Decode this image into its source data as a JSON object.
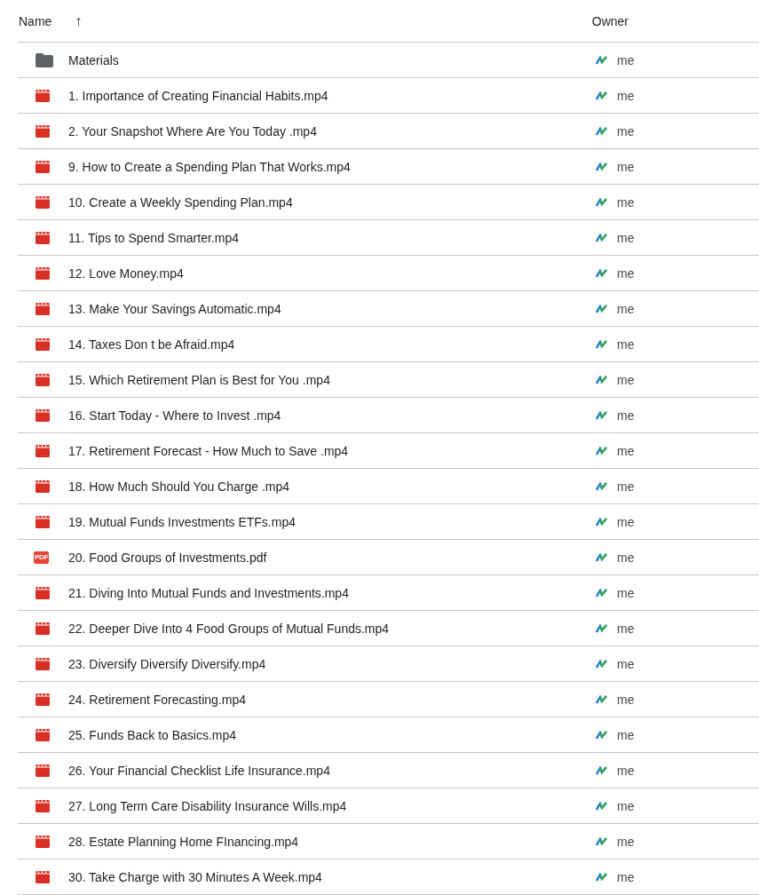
{
  "header": {
    "name_label": "Name",
    "sort_arrow": "↑",
    "owner_label": "Owner"
  },
  "files": [
    {
      "kind": "folder",
      "name": "Materials",
      "owner": "me"
    },
    {
      "kind": "video",
      "name": "1. Importance of Creating Financial Habits.mp4",
      "owner": "me"
    },
    {
      "kind": "video",
      "name": "2. Your Snapshot Where Are You Today .mp4",
      "owner": "me"
    },
    {
      "kind": "video",
      "name": "9. How to Create a Spending Plan That Works.mp4",
      "owner": "me"
    },
    {
      "kind": "video",
      "name": "10. Create a Weekly Spending Plan.mp4",
      "owner": "me"
    },
    {
      "kind": "video",
      "name": "11. Tips to Spend Smarter.mp4",
      "owner": "me"
    },
    {
      "kind": "video",
      "name": "12. Love Money.mp4",
      "owner": "me"
    },
    {
      "kind": "video",
      "name": "13. Make Your Savings Automatic.mp4",
      "owner": "me"
    },
    {
      "kind": "video",
      "name": "14. Taxes Don t be Afraid.mp4",
      "owner": "me"
    },
    {
      "kind": "video",
      "name": "15. Which Retirement Plan is Best for You .mp4",
      "owner": "me"
    },
    {
      "kind": "video",
      "name": "16. Start Today - Where to Invest .mp4",
      "owner": "me"
    },
    {
      "kind": "video",
      "name": "17. Retirement Forecast - How Much to Save .mp4",
      "owner": "me"
    },
    {
      "kind": "video",
      "name": "18. How Much Should You Charge .mp4",
      "owner": "me"
    },
    {
      "kind": "video",
      "name": "19. Mutual Funds Investments ETFs.mp4",
      "owner": "me"
    },
    {
      "kind": "pdf",
      "icon_label": "PDF",
      "name": "20. Food Groups of Investments.pdf",
      "owner": "me"
    },
    {
      "kind": "video",
      "name": "21. Diving Into Mutual Funds and Investments.mp4",
      "owner": "me"
    },
    {
      "kind": "video",
      "name": "22. Deeper Dive Into 4 Food Groups of Mutual Funds.mp4",
      "owner": "me"
    },
    {
      "kind": "video",
      "name": "23. Diversify Diversify Diversify.mp4",
      "owner": "me"
    },
    {
      "kind": "video",
      "name": "24. Retirement Forecasting.mp4",
      "owner": "me"
    },
    {
      "kind": "video",
      "name": "25. Funds Back to Basics.mp4",
      "owner": "me"
    },
    {
      "kind": "video",
      "name": "26. Your Financial Checklist Life Insurance.mp4",
      "owner": "me"
    },
    {
      "kind": "video",
      "name": "27. Long Term Care Disability Insurance Wills.mp4",
      "owner": "me"
    },
    {
      "kind": "video",
      "name": "28. Estate Planning Home FInancing.mp4",
      "owner": "me"
    },
    {
      "kind": "video",
      "name": "30. Take Charge with 30 Minutes A Week.mp4",
      "owner": "me"
    }
  ]
}
